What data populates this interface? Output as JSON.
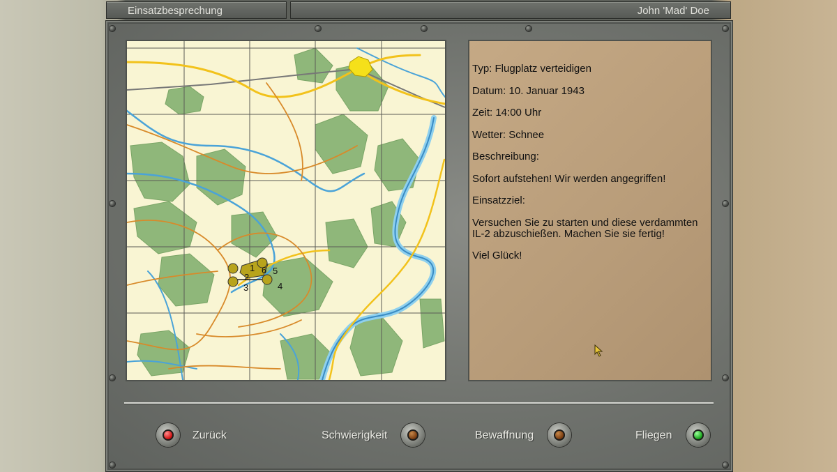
{
  "header": {
    "left_title": "Einsatzbesprechung",
    "right_title": "John 'Mad' Doe"
  },
  "map": {
    "unit_labels": [
      "1",
      "2",
      "3",
      "4",
      "5",
      "6"
    ]
  },
  "briefing": {
    "type": "Typ: Flugplatz verteidigen",
    "date": "Datum: 10. Januar 1943",
    "time": "Zeit: 14:00 Uhr",
    "weather": "Wetter: Schnee",
    "description_heading": "Beschreibung:",
    "description": "Sofort aufstehen! Wir werden angegriffen!",
    "objective_heading": "Einsatzziel:",
    "objective": "Versuchen Sie zu starten und diese verdammten IL-2 abzuschießen. Machen Sie sie fertig!",
    "closing": "Viel Glück!"
  },
  "buttons": {
    "back": {
      "label": "Zurück",
      "lamp": "red"
    },
    "difficulty": {
      "label": "Schwierigkeit",
      "lamp": "amber"
    },
    "armament": {
      "label": "Bewaffnung",
      "lamp": "amber"
    },
    "fly": {
      "label": "Fliegen",
      "lamp": "green"
    }
  },
  "colors": {
    "map_paper": "#f9f5d3",
    "forest": "#8fb77a",
    "river": "#4aa3d8",
    "road_major": "#f2c21b",
    "road_minor": "#d88a2a",
    "railway": "#777777",
    "unit_marker": "#b8a41c",
    "briefing_bg": "#c5a985"
  }
}
